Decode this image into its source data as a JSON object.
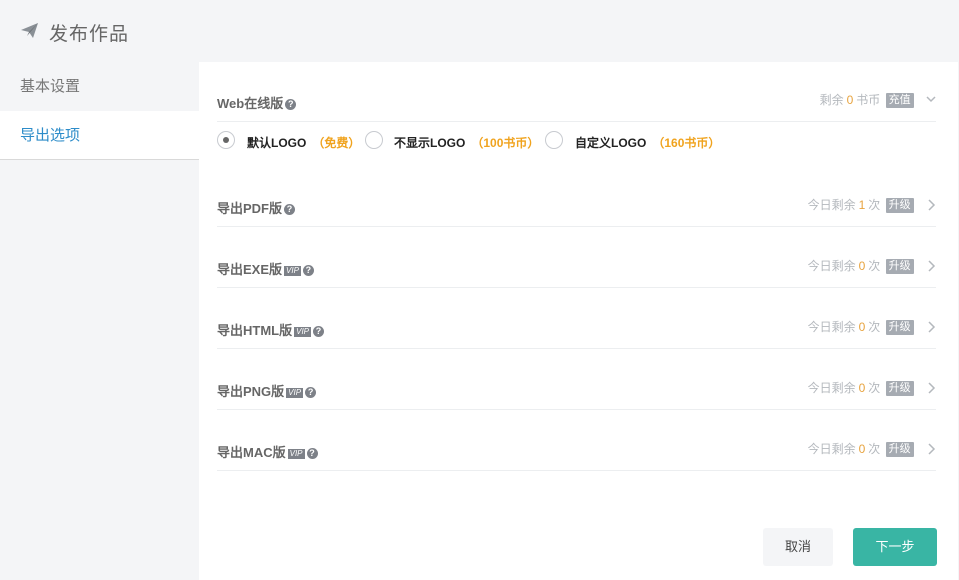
{
  "header": {
    "title": "发布作品",
    "icon": "paper-plane-icon"
  },
  "sidebar": {
    "items": [
      {
        "label": "基本设置"
      },
      {
        "label": "导出选项"
      }
    ]
  },
  "web": {
    "label": "Web在线版",
    "remain_prefix": "剩余",
    "remain_value": "0",
    "remain_unit": "书币",
    "action": "充值",
    "options": [
      {
        "label": "默认LOGO",
        "price": "（免费）",
        "selected": true
      },
      {
        "label": "不显示LOGO",
        "price": "（100书币）",
        "selected": false
      },
      {
        "label": "自定义LOGO",
        "price": "（160书币）",
        "selected": false
      }
    ]
  },
  "exports": [
    {
      "label": "导出PDF版",
      "vip": false,
      "vip_text": "",
      "prefix": "今日剩余",
      "value": "1",
      "unit": "次",
      "action": "升级"
    },
    {
      "label": "导出EXE版",
      "vip": true,
      "vip_text": "VIP",
      "prefix": "今日剩余",
      "value": "0",
      "unit": "次",
      "action": "升级"
    },
    {
      "label": "导出HTML版",
      "vip": true,
      "vip_text": "VIP",
      "prefix": "今日剩余",
      "value": "0",
      "unit": "次",
      "action": "升级"
    },
    {
      "label": "导出PNG版",
      "vip": true,
      "vip_text": "VIP",
      "prefix": "今日剩余",
      "value": "0",
      "unit": "次",
      "action": "升级"
    },
    {
      "label": "导出MAC版",
      "vip": true,
      "vip_text": "VIP",
      "prefix": "今日剩余",
      "value": "0",
      "unit": "次",
      "action": "升级"
    }
  ],
  "footer": {
    "cancel": "取消",
    "next": "下一步"
  },
  "colors": {
    "accent": "#2d8cc9",
    "primary_button": "#39b5a4",
    "highlight_number": "#e7a33e",
    "price": "#f0a31e"
  }
}
